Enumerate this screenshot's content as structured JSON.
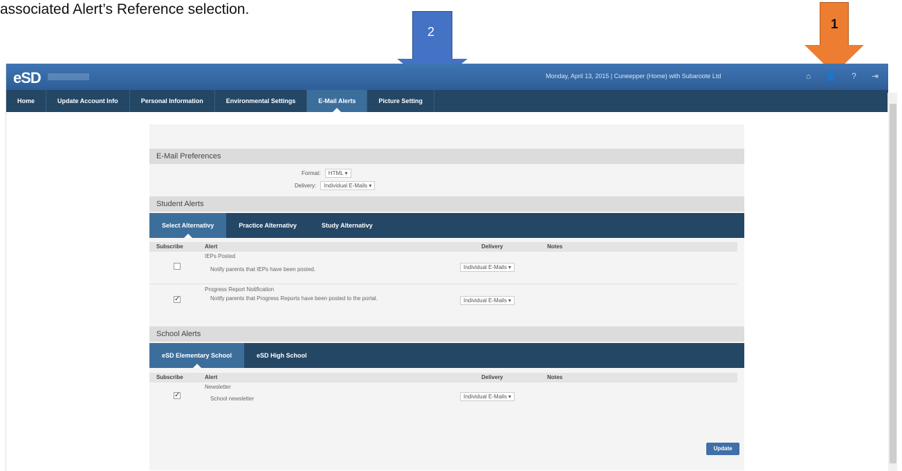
{
  "caption": "associated Alert’s Reference selection.",
  "annotations": {
    "arrow_blue_number": "2",
    "arrow_orange_number": "1",
    "colors": {
      "blue": "#4472c4",
      "orange": "#ed7d31"
    }
  },
  "topbar": {
    "logo": "eSD",
    "info": "Monday, April 13, 2015 | Cuneepper (Home) with Subaroote Ltd",
    "icons": [
      "home-icon",
      "user-icon",
      "help-icon",
      "logout-icon"
    ]
  },
  "nav": {
    "items": [
      {
        "label": "Home"
      },
      {
        "label": "Update Account Info"
      },
      {
        "label": "Personal Information"
      },
      {
        "label": "Environmental Settings"
      },
      {
        "label": "E-Mail Alerts"
      },
      {
        "label": "Picture Setting"
      }
    ],
    "active_index": 4
  },
  "buttons": {
    "update": "Update"
  },
  "email_prefs": {
    "header": "E-Mail Preferences",
    "format_label": "Format:",
    "format_value": "HTML",
    "delivery_label": "Delivery:",
    "delivery_value": "Individual E-Mails"
  },
  "student_alerts": {
    "header": "Student Alerts",
    "tabs": [
      "Select Alternativy",
      "Practice Alternativy",
      "Study Alternativy"
    ],
    "columns": {
      "subscribe": "Subscribe",
      "alert": "Alert",
      "delivery": "Delivery",
      "notes": "Notes"
    },
    "rows": [
      {
        "title": "IEPs Posted",
        "desc": "Notify parents that IEPs have been posted.",
        "checked": false,
        "delivery": "Individual E-Mails"
      },
      {
        "title": "Progress Report Notification",
        "desc": "Notify parents that Progress Reports have been posted to the portal.",
        "checked": true,
        "delivery": "Individual E-Mails"
      }
    ]
  },
  "school_alerts": {
    "header": "School Alerts",
    "tabs": [
      "eSD Elementary School",
      "eSD High School"
    ],
    "columns": {
      "subscribe": "Subscribe",
      "alert": "Alert",
      "delivery": "Delivery",
      "notes": "Notes"
    },
    "rows": [
      {
        "title": "Newsletter",
        "desc": "School newsletter",
        "checked": true,
        "delivery": "Individual E-Mails"
      }
    ]
  }
}
